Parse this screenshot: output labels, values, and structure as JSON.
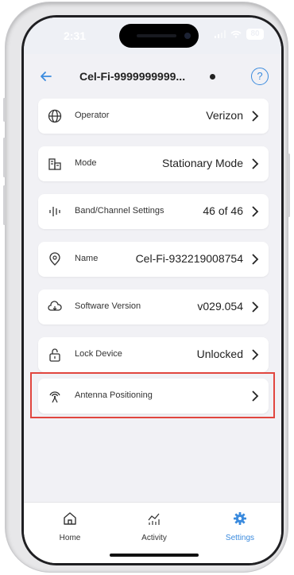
{
  "status": {
    "time": "2:31",
    "battery": "80"
  },
  "header": {
    "title": "Cel-Fi-9999999999..."
  },
  "rows": [
    {
      "label": "Operator",
      "value": "Verizon",
      "icon": "globe-icon"
    },
    {
      "label": "Mode",
      "value": "Stationary Mode",
      "icon": "building-icon"
    },
    {
      "label": "Band/Channel Settings",
      "value": "46 of 46",
      "icon": "signal-bars-icon"
    },
    {
      "label": "Name",
      "value": "Cel-Fi-932219008754",
      "icon": "location-pin-icon"
    },
    {
      "label": "Software Version",
      "value": "v029.054",
      "icon": "cloud-download-icon"
    },
    {
      "label": "Lock Device",
      "value": "Unlocked",
      "icon": "lock-icon"
    },
    {
      "label": "Antenna Positioning",
      "value": "",
      "icon": "antenna-icon"
    }
  ],
  "tabs": [
    {
      "label": "Home",
      "icon": "home-icon"
    },
    {
      "label": "Activity",
      "icon": "activity-chart-icon"
    },
    {
      "label": "Settings",
      "icon": "gear-icon"
    }
  ],
  "colors": {
    "accent": "#3b8bde",
    "highlight_border": "#e1463f"
  }
}
